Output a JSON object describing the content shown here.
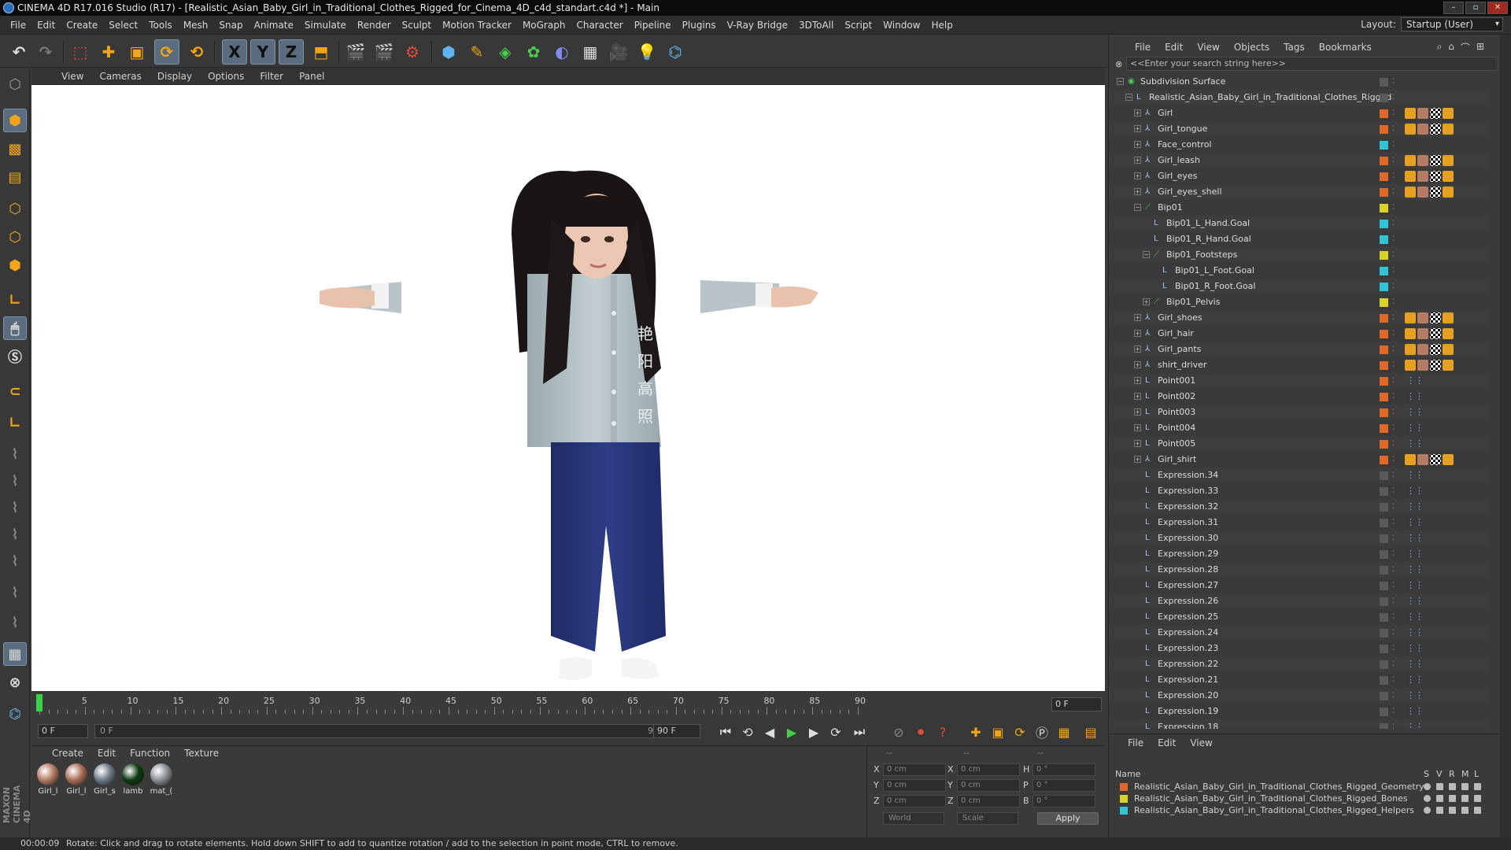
{
  "window": {
    "title": "CINEMA 4D R17.016 Studio (R17) - [Realistic_Asian_Baby_Girl_in_Traditional_Clothes_Rigged_for_Cinema_4D_c4d_standart.c4d *] - Main"
  },
  "menu": [
    "File",
    "Edit",
    "Create",
    "Select",
    "Tools",
    "Mesh",
    "Snap",
    "Animate",
    "Simulate",
    "Render",
    "Sculpt",
    "Motion Tracker",
    "MoGraph",
    "Character",
    "Pipeline",
    "Plugins",
    "V-Ray Bridge",
    "3DToAll",
    "Script",
    "Window",
    "Help"
  ],
  "layout": {
    "label": "Layout:",
    "value": "Startup (User)"
  },
  "toolbar": {
    "x_label": "X",
    "y_label": "Y",
    "z_label": "Z"
  },
  "viewport_menu": [
    "View",
    "Cameras",
    "Display",
    "Options",
    "Filter",
    "Panel"
  ],
  "timeline": {
    "ticks": [
      "0",
      "5",
      "10",
      "15",
      "20",
      "25",
      "30",
      "35",
      "40",
      "45",
      "50",
      "55",
      "60",
      "65",
      "70",
      "75",
      "80",
      "85",
      "90"
    ],
    "end_frame": "0 F"
  },
  "transport": {
    "current": "0 F",
    "range_start": "0 F",
    "range_end": "90 F",
    "max": "90 F"
  },
  "materials": {
    "menu": [
      "Create",
      "Edit",
      "Function",
      "Texture"
    ],
    "items": [
      {
        "label": "Girl_l",
        "color": "#b37b62"
      },
      {
        "label": "Girl_l",
        "color": "#a86e57"
      },
      {
        "label": "Girl_s",
        "color": "#6d7a86"
      },
      {
        "label": "lamb",
        "color": "#0d3b10"
      },
      {
        "label": "mat_(",
        "color": "#8a8f94"
      }
    ]
  },
  "coords": {
    "headers": [
      "--",
      "--",
      "--"
    ],
    "rows": [
      {
        "a": "X",
        "av": "0 cm",
        "b": "X",
        "bv": "0 cm",
        "c": "H",
        "cv": "0 °"
      },
      {
        "a": "Y",
        "av": "0 cm",
        "b": "Y",
        "bv": "0 cm",
        "c": "P",
        "cv": "0 °"
      },
      {
        "a": "Z",
        "av": "0 cm",
        "b": "Z",
        "bv": "0 cm",
        "c": "B",
        "cv": "0 °"
      }
    ],
    "world": "World",
    "scale": "Scale",
    "apply": "Apply"
  },
  "status": {
    "time": "00:00:09",
    "message": "Rotate: Click and drag to rotate elements. Hold down SHIFT to add to quantize rotation / add to the selection in point mode, CTRL to remove."
  },
  "objects": {
    "menu": [
      "File",
      "Edit",
      "View",
      "Objects",
      "Tags",
      "Bookmarks"
    ],
    "search_placeholder": "<<Enter your search string here>>",
    "items": [
      {
        "name": "Subdivision Surface",
        "indent": 0,
        "swatch": "",
        "icon": "subdiv"
      },
      {
        "name": "Realistic_Asian_Baby_Girl_in_Traditional_Clothes_Rigged",
        "indent": 1,
        "swatch": "",
        "icon": "null"
      },
      {
        "name": "Girl",
        "indent": 2,
        "swatch": "#e0692a",
        "icon": "bone"
      },
      {
        "name": "Girl_tongue",
        "indent": 2,
        "swatch": "#e0692a",
        "icon": "bone"
      },
      {
        "name": "Face_control",
        "indent": 2,
        "swatch": "#2fc4d6",
        "icon": "bone"
      },
      {
        "name": "Girl_leash",
        "indent": 2,
        "swatch": "#e0692a",
        "icon": "bone"
      },
      {
        "name": "Girl_eyes",
        "indent": 2,
        "swatch": "#e0692a",
        "icon": "bone"
      },
      {
        "name": "Girl_eyes_shell",
        "indent": 2,
        "swatch": "#e0692a",
        "icon": "bone"
      },
      {
        "name": "Bip01",
        "indent": 2,
        "swatch": "#d8d22a",
        "icon": "joint"
      },
      {
        "name": "Bip01_L_Hand.Goal",
        "indent": 3,
        "swatch": "#2fc4d6",
        "icon": "null"
      },
      {
        "name": "Bip01_R_Hand.Goal",
        "indent": 3,
        "swatch": "#2fc4d6",
        "icon": "null"
      },
      {
        "name": "Bip01_Footsteps",
        "indent": 3,
        "swatch": "#d8d22a",
        "icon": "joint"
      },
      {
        "name": "Bip01_L_Foot.Goal",
        "indent": 4,
        "swatch": "#2fc4d6",
        "icon": "null"
      },
      {
        "name": "Bip01_R_Foot.Goal",
        "indent": 4,
        "swatch": "#2fc4d6",
        "icon": "null"
      },
      {
        "name": "Bip01_Pelvis",
        "indent": 3,
        "swatch": "#d8d22a",
        "icon": "joint"
      },
      {
        "name": "Girl_shoes",
        "indent": 2,
        "swatch": "#e0692a",
        "icon": "bone"
      },
      {
        "name": "Girl_hair",
        "indent": 2,
        "swatch": "#e0692a",
        "icon": "bone"
      },
      {
        "name": "Girl_pants",
        "indent": 2,
        "swatch": "#e0692a",
        "icon": "bone"
      },
      {
        "name": "shirt_driver",
        "indent": 2,
        "swatch": "#e0692a",
        "icon": "bone"
      },
      {
        "name": "Point001",
        "indent": 2,
        "swatch": "#e0692a",
        "icon": "null"
      },
      {
        "name": "Point002",
        "indent": 2,
        "swatch": "#e0692a",
        "icon": "null"
      },
      {
        "name": "Point003",
        "indent": 2,
        "swatch": "#e0692a",
        "icon": "null"
      },
      {
        "name": "Point004",
        "indent": 2,
        "swatch": "#e0692a",
        "icon": "null"
      },
      {
        "name": "Point005",
        "indent": 2,
        "swatch": "#e0692a",
        "icon": "null"
      },
      {
        "name": "Girl_shirt",
        "indent": 2,
        "swatch": "#e0692a",
        "icon": "bone"
      },
      {
        "name": "Expression.34",
        "indent": 2,
        "swatch": "",
        "icon": "null"
      },
      {
        "name": "Expression.33",
        "indent": 2,
        "swatch": "",
        "icon": "null"
      },
      {
        "name": "Expression.32",
        "indent": 2,
        "swatch": "",
        "icon": "null"
      },
      {
        "name": "Expression.31",
        "indent": 2,
        "swatch": "",
        "icon": "null"
      },
      {
        "name": "Expression.30",
        "indent": 2,
        "swatch": "",
        "icon": "null"
      },
      {
        "name": "Expression.29",
        "indent": 2,
        "swatch": "",
        "icon": "null"
      },
      {
        "name": "Expression.28",
        "indent": 2,
        "swatch": "",
        "icon": "null"
      },
      {
        "name": "Expression.27",
        "indent": 2,
        "swatch": "",
        "icon": "null"
      },
      {
        "name": "Expression.26",
        "indent": 2,
        "swatch": "",
        "icon": "null"
      },
      {
        "name": "Expression.25",
        "indent": 2,
        "swatch": "",
        "icon": "null"
      },
      {
        "name": "Expression.24",
        "indent": 2,
        "swatch": "",
        "icon": "null"
      },
      {
        "name": "Expression.23",
        "indent": 2,
        "swatch": "",
        "icon": "null"
      },
      {
        "name": "Expression.22",
        "indent": 2,
        "swatch": "",
        "icon": "null"
      },
      {
        "name": "Expression.21",
        "indent": 2,
        "swatch": "",
        "icon": "null"
      },
      {
        "name": "Expression.20",
        "indent": 2,
        "swatch": "",
        "icon": "null"
      },
      {
        "name": "Expression.19",
        "indent": 2,
        "swatch": "",
        "icon": "null"
      },
      {
        "name": "Expression.18",
        "indent": 2,
        "swatch": "",
        "icon": "null"
      }
    ]
  },
  "layers": {
    "menu": [
      "File",
      "Edit",
      "View"
    ],
    "header": {
      "name": "Name",
      "cols": [
        "S",
        "V",
        "R",
        "M",
        "L"
      ]
    },
    "items": [
      {
        "name": "Realistic_Asian_Baby_Girl_in_Traditional_Clothes_Rigged_Geometry",
        "color": "#e0692a"
      },
      {
        "name": "Realistic_Asian_Baby_Girl_in_Traditional_Clothes_Rigged_Bones",
        "color": "#d8d22a"
      },
      {
        "name": "Realistic_Asian_Baby_Girl_in_Traditional_Clothes_Rigged_Helpers",
        "color": "#2fc4d6"
      }
    ]
  },
  "shirt_text": [
    "艳",
    "阳",
    "高",
    "照"
  ],
  "brand": "MAXON CINEMA 4D"
}
